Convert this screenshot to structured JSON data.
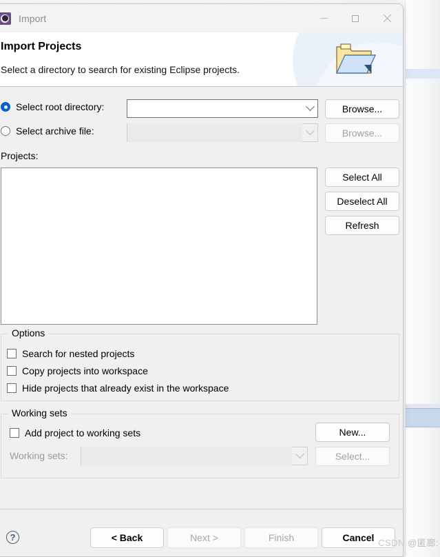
{
  "window": {
    "title": "Import",
    "app_icon": "eclipse-gear-icon",
    "controls": {
      "minimize": "minimize-icon",
      "maximize": "maximize-icon",
      "close": "close-icon"
    }
  },
  "header": {
    "title": "Import Projects",
    "subtitle": "Select a directory to search for existing Eclipse projects.",
    "icon": "open-folder-icon"
  },
  "source": {
    "root_directory": {
      "label": "Select root directory:",
      "selected": true,
      "value": "",
      "placeholder": "",
      "browse_label": "Browse..."
    },
    "archive_file": {
      "label": "Select archive file:",
      "selected": false,
      "disabled": true,
      "value": "",
      "placeholder": "",
      "browse_label": "Browse..."
    }
  },
  "projects": {
    "label": "Projects:",
    "items": [],
    "buttons": {
      "select_all": "Select All",
      "deselect_all": "Deselect All",
      "refresh": "Refresh"
    }
  },
  "options": {
    "title": "Options",
    "checkboxes": [
      {
        "label": "Search for nested projects",
        "checked": false
      },
      {
        "label": "Copy projects into workspace",
        "checked": false
      },
      {
        "label": "Hide projects that already exist in the workspace",
        "checked": false
      }
    ]
  },
  "working_sets": {
    "title": "Working sets",
    "add_checkbox": {
      "label": "Add project to working sets",
      "checked": false
    },
    "new_button": "New...",
    "sets_label": "Working sets:",
    "sets_value": "",
    "sets_disabled": true,
    "select_button": "Select..."
  },
  "footer": {
    "help": "?",
    "back": "< Back",
    "next": "Next >",
    "finish": "Finish",
    "cancel": "Cancel",
    "back_disabled": false,
    "next_disabled": true,
    "finish_disabled": true,
    "cancel_disabled": false
  },
  "watermark": {
    "brand": "CSDN",
    "user": "@匿廊:"
  },
  "colors": {
    "accent": "#0a62c7",
    "dialog_bg": "#f0f0f0",
    "header_bg": "#ffffff",
    "title_bar_bg": "#f3f3f3",
    "icon_purple": "#6b4d82"
  }
}
